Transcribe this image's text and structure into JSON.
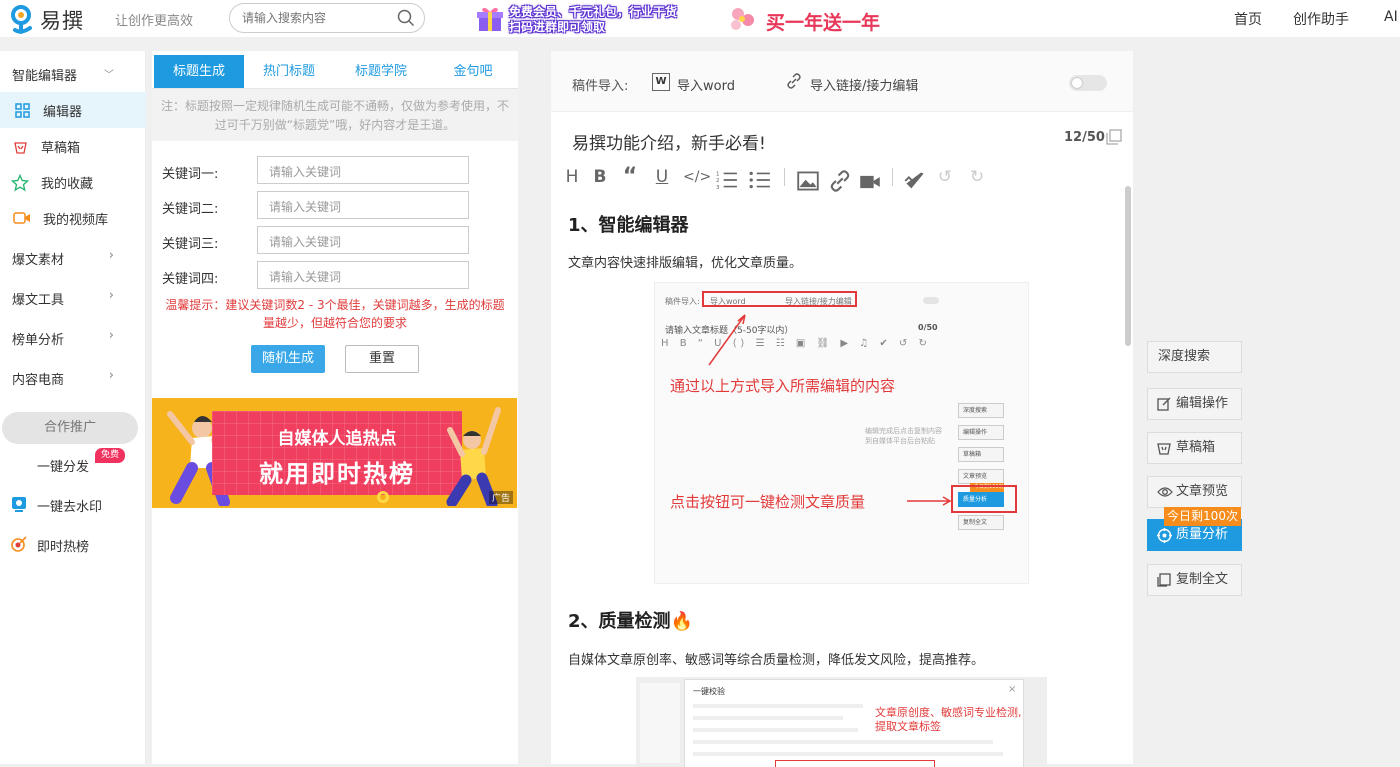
{
  "header": {
    "logo_text": "易撰",
    "slogan": "让创作更高效",
    "search_placeholder": "请输入搜索内容",
    "promo1_line1": "免费会员、千元礼包，行业干货",
    "promo1_line2": "扫码进群即可领取",
    "promo2_text": "买一年送一年",
    "nav": [
      "首页",
      "创作助手",
      "AI"
    ]
  },
  "sidebar": {
    "items": [
      {
        "label": "智能编辑器",
        "arrow": "﹀"
      },
      {
        "label": "编辑器"
      },
      {
        "label": "草稿箱"
      },
      {
        "label": "我的收藏"
      },
      {
        "label": "我的视频库"
      },
      {
        "label": "爆文素材",
        "arrow": "›"
      },
      {
        "label": "爆文工具",
        "arrow": "›"
      },
      {
        "label": "榜单分析",
        "arrow": "›"
      },
      {
        "label": "内容电商",
        "arrow": "›"
      }
    ],
    "coop_label": "合作推广",
    "coop_items": [
      "一键分发",
      "一键去水印",
      "即时热榜"
    ],
    "free_badge": "免费"
  },
  "title_panel": {
    "tabs": [
      "标题生成",
      "热门标题",
      "标题学院",
      "金句吧"
    ],
    "notice": "注：标题按照一定规律随机生成可能不通畅，仅做为参考使用，不过可千万别做“标题党”哦，好内容才是王道。",
    "keywords": [
      {
        "label": "关键词一:",
        "placeholder": "请输入关键词"
      },
      {
        "label": "关键词二:",
        "placeholder": "请输入关键词"
      },
      {
        "label": "关键词三:",
        "placeholder": "请输入关键词"
      },
      {
        "label": "关键词四:",
        "placeholder": "请输入关键词"
      }
    ],
    "tip": "温馨提示：建议关键词数2 - 3个最佳，关键词越多，生成的标题量越少，但越符合您的要求",
    "btn_random": "随机生成",
    "btn_reset": "重置",
    "banner_line1": "自媒体人追热点",
    "banner_line2": "就用即时热榜",
    "ad_tag": "广告"
  },
  "editor": {
    "import_label": "稿件导入:",
    "import_word_icon": "W",
    "import_word": "导入word",
    "import_link": "导入链接/接力编辑",
    "doc_title": "易撰功能介绍，新手必看!",
    "char_count": "12/50",
    "heading1": "1、智能编辑器",
    "para1": "文章内容快速排版编辑，优化文章质量。",
    "shot1": {
      "import_label": "稿件导入:",
      "import_word": "导入word",
      "import_link": "导入链接/接力编辑",
      "title_placeholder": "请输入文章标题（5-50字以内）",
      "count": "0/50",
      "caption1": "通过以上方式导入所需编辑的内容",
      "side_note": "编辑完成后点击复制内容到自媒体平台后台粘贴",
      "caption2": "点击按钮可一键检测文章质量",
      "mini_buttons": [
        "深度搜索",
        "编辑操作",
        "草稿箱",
        "文章预览",
        "质量分析",
        "复制全文"
      ],
      "mini_badge": "今日剩100次"
    },
    "heading2": "2、质量检测🔥",
    "para2": "自媒体文章原创率、敏感词等综合质量检测，降低发文风险，提高推荐。",
    "shot2": {
      "dialog_title": "一键校验",
      "caption": "文章原创度、敏感词专业检测,提取文章标签"
    }
  },
  "right_buttons": {
    "items": [
      "深度搜索",
      "编辑操作",
      "草稿箱",
      "文章预览",
      "质量分析",
      "复制全文"
    ],
    "badge": "今日剩100次"
  },
  "colors": {
    "accent": "#1e9ae0",
    "warning": "#e03c3c",
    "badge_orange": "#f58c1b"
  }
}
